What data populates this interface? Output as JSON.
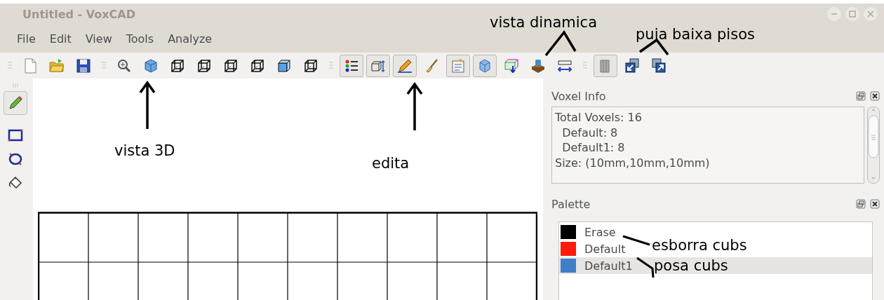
{
  "window": {
    "title": "Untitled - VoxCAD"
  },
  "menu": [
    "File",
    "Edit",
    "View",
    "Tools",
    "Analyze"
  ],
  "toolbar": [
    [
      {
        "kind": "new",
        "pressed": false
      },
      {
        "kind": "open",
        "pressed": false
      },
      {
        "kind": "save",
        "pressed": false
      }
    ],
    [
      {
        "kind": "zoom",
        "pressed": false
      },
      {
        "kind": "cube",
        "pressed": false
      },
      {
        "kind": "wire",
        "pressed": false
      },
      {
        "kind": "wire",
        "pressed": false
      },
      {
        "kind": "wire",
        "pressed": false
      },
      {
        "kind": "wire",
        "pressed": false
      },
      {
        "kind": "cube-side",
        "pressed": false
      },
      {
        "kind": "wire",
        "pressed": false
      }
    ],
    [
      {
        "kind": "list",
        "pressed": true
      },
      {
        "kind": "dims",
        "pressed": true
      },
      {
        "kind": "edit",
        "pressed": true
      },
      {
        "kind": "brush",
        "pressed": false
      },
      {
        "kind": "props",
        "pressed": true
      },
      {
        "kind": "cube3d",
        "pressed": true
      },
      {
        "kind": "box-arrow",
        "pressed": false
      },
      {
        "kind": "layers",
        "pressed": false
      },
      {
        "kind": "resize",
        "pressed": false
      }
    ],
    [
      {
        "kind": "library",
        "pressed": true
      },
      {
        "kind": "floor-down",
        "pressed": false
      },
      {
        "kind": "floor-up",
        "pressed": false
      }
    ]
  ],
  "tools": [
    {
      "kind": "pencil",
      "pressed": true
    },
    {
      "kind": "rect",
      "pressed": false
    },
    {
      "kind": "ellipse",
      "pressed": false
    },
    {
      "kind": "bucket",
      "pressed": false
    }
  ],
  "voxel_info": {
    "title": "Voxel Info",
    "lines": [
      "Total Voxels: 16",
      "  Default: 8",
      "  Default1: 8",
      "Size: (10mm,10mm,10mm)"
    ]
  },
  "palette": {
    "title": "Palette",
    "items": [
      {
        "label": "Erase",
        "color": "#000000",
        "selected": false
      },
      {
        "label": "Default",
        "color": "#ff1a0a",
        "selected": false
      },
      {
        "label": "Default1",
        "color": "#3f7fca",
        "selected": true
      }
    ]
  },
  "annotations": [
    "vista dinamica",
    "puja baixa pisos",
    "vista 3D",
    "edita",
    "esborra cubs",
    "posa cubs"
  ]
}
